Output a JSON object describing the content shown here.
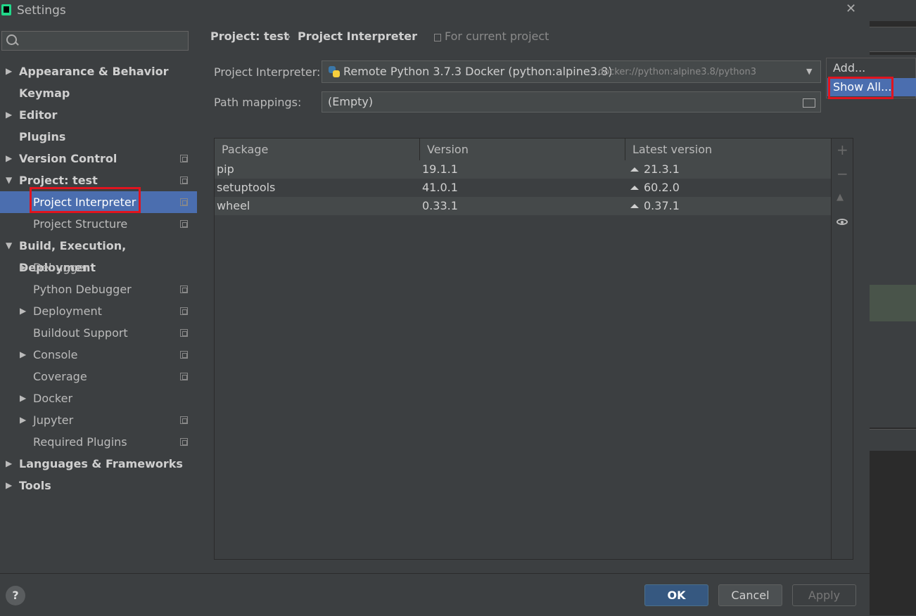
{
  "window": {
    "title": "Settings",
    "close": "✕"
  },
  "sidebar": {
    "items": [
      {
        "label": "Appearance & Behavior"
      },
      {
        "label": "Keymap"
      },
      {
        "label": "Editor"
      },
      {
        "label": "Plugins"
      },
      {
        "label": "Version Control"
      },
      {
        "label": "Project: test"
      },
      {
        "label": "Project Interpreter"
      },
      {
        "label": "Project Structure"
      },
      {
        "label": "Build, Execution, Deployment"
      },
      {
        "label": "Debugger"
      },
      {
        "label": "Python Debugger"
      },
      {
        "label": "Deployment"
      },
      {
        "label": "Buildout Support"
      },
      {
        "label": "Console"
      },
      {
        "label": "Coverage"
      },
      {
        "label": "Docker"
      },
      {
        "label": "Jupyter"
      },
      {
        "label": "Required Plugins"
      },
      {
        "label": "Languages & Frameworks"
      },
      {
        "label": "Tools"
      }
    ]
  },
  "breadcrumb": {
    "project": "Project: test",
    "separator": "›",
    "current": "Project Interpreter",
    "scope": "For current project"
  },
  "interpreter": {
    "label": "Project Interpreter:",
    "name": "Remote Python 3.7.3 Docker (python:alpine3.8)",
    "path": "docker://python:alpine3.8/python3"
  },
  "path_mappings": {
    "label": "Path mappings:",
    "value": "(Empty)"
  },
  "popup": {
    "add": "Add...",
    "show_all": "Show All..."
  },
  "table": {
    "headers": [
      "Package",
      "Version",
      "Latest version"
    ],
    "rows": [
      {
        "package": "pip",
        "version": "19.1.1",
        "latest": "21.3.1"
      },
      {
        "package": "setuptools",
        "version": "41.0.1",
        "latest": "60.2.0"
      },
      {
        "package": "wheel",
        "version": "0.33.1",
        "latest": "0.37.1"
      }
    ]
  },
  "toolbar": {
    "add": "+",
    "remove": "−",
    "upgrade": "▲"
  },
  "footer": {
    "help": "?",
    "ok": "OK",
    "cancel": "Cancel",
    "apply": "Apply"
  }
}
